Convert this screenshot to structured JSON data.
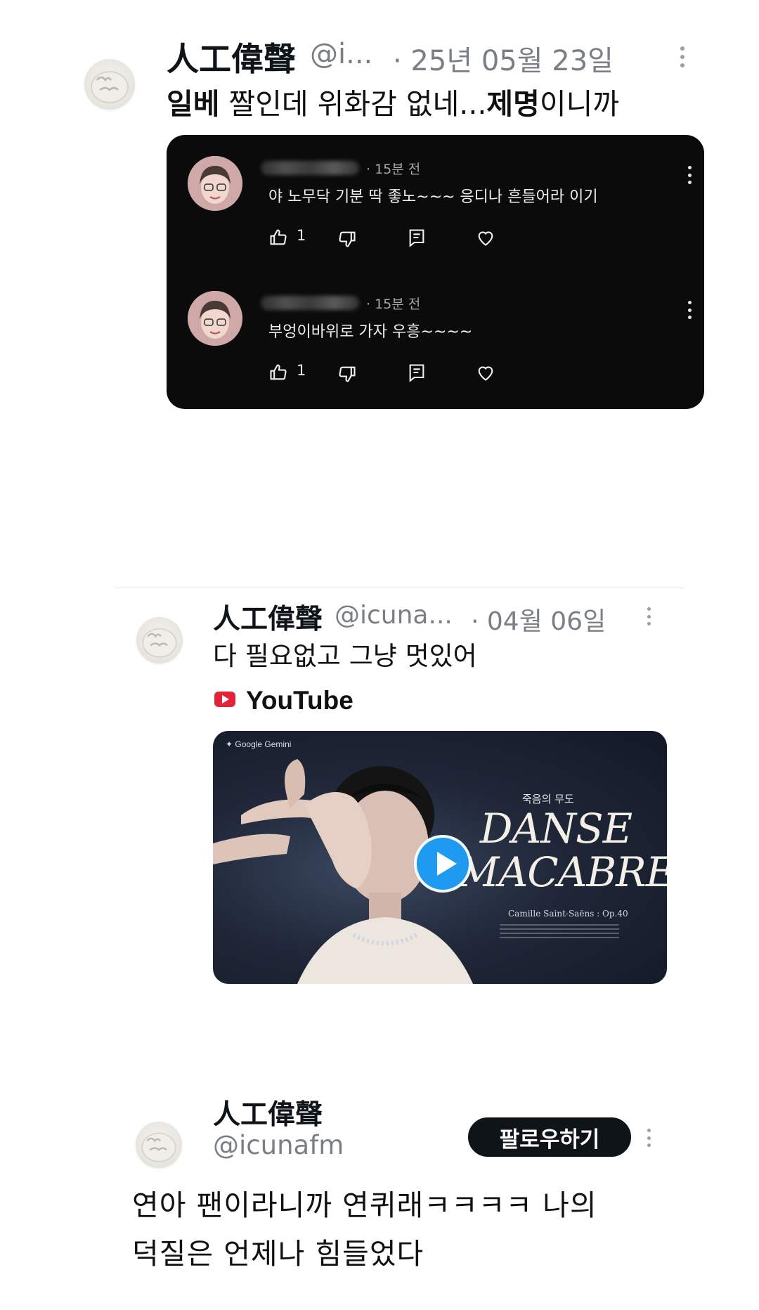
{
  "tweet1": {
    "display_name": "人工偉聲",
    "handle": "@i...",
    "date": "· 25년 05월 23일",
    "text_bold1": "일베",
    "text_part1": " 짤인데 위화감 없네...",
    "text_bold2": "제명",
    "text_part2": "이니까",
    "embedded_comments": [
      {
        "time": "· 15분 전",
        "text": "야 노무닥 기분 딱 좋노~~~ 응디나 흔들어라 이기",
        "like_count": "1"
      },
      {
        "time": "· 15분 전",
        "text": "부엉이바위로 가자 우흥~~~~",
        "like_count": "1"
      }
    ]
  },
  "tweet2": {
    "display_name": "人工偉聲",
    "handle": "@icuna...",
    "date": "· 04월 06일",
    "text": "다 필요없고 그냥 멋있어",
    "source_label": "YouTube",
    "video": {
      "brand": "✦ Google Gemini",
      "subtitle": "죽음의 무도",
      "title_line1": "DANSE",
      "title_line2": "MACABRE",
      "credit": "Camille Saint-Saëns : Op.40"
    }
  },
  "tweet3": {
    "display_name": "人工偉聲",
    "handle": "@icunafm",
    "follow_label": "팔로우하기",
    "text_line1": "연아 팬이라니까 연퀴래ㅋㅋㅋㅋ 나의",
    "text_line2": "덕질은 언제나 힘들었다"
  },
  "colors": {
    "card_bg": "#0b0b0b",
    "muted": "#7a7f85",
    "play_blue": "#1e9bf0",
    "youtube_red": "#e4223a",
    "follow_bg": "#0f1419"
  }
}
